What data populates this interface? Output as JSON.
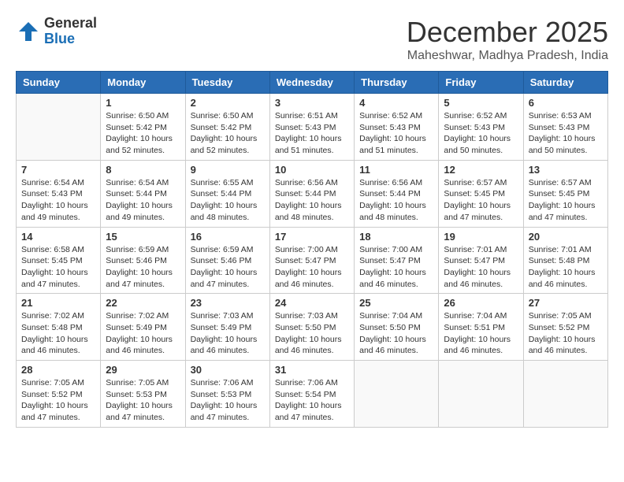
{
  "header": {
    "logo_general": "General",
    "logo_blue": "Blue",
    "month_title": "December 2025",
    "location": "Maheshwar, Madhya Pradesh, India"
  },
  "weekdays": [
    "Sunday",
    "Monday",
    "Tuesday",
    "Wednesday",
    "Thursday",
    "Friday",
    "Saturday"
  ],
  "weeks": [
    [
      {
        "day": "",
        "info": ""
      },
      {
        "day": "1",
        "info": "Sunrise: 6:50 AM\nSunset: 5:42 PM\nDaylight: 10 hours\nand 52 minutes."
      },
      {
        "day": "2",
        "info": "Sunrise: 6:50 AM\nSunset: 5:42 PM\nDaylight: 10 hours\nand 52 minutes."
      },
      {
        "day": "3",
        "info": "Sunrise: 6:51 AM\nSunset: 5:43 PM\nDaylight: 10 hours\nand 51 minutes."
      },
      {
        "day": "4",
        "info": "Sunrise: 6:52 AM\nSunset: 5:43 PM\nDaylight: 10 hours\nand 51 minutes."
      },
      {
        "day": "5",
        "info": "Sunrise: 6:52 AM\nSunset: 5:43 PM\nDaylight: 10 hours\nand 50 minutes."
      },
      {
        "day": "6",
        "info": "Sunrise: 6:53 AM\nSunset: 5:43 PM\nDaylight: 10 hours\nand 50 minutes."
      }
    ],
    [
      {
        "day": "7",
        "info": "Sunrise: 6:54 AM\nSunset: 5:43 PM\nDaylight: 10 hours\nand 49 minutes."
      },
      {
        "day": "8",
        "info": "Sunrise: 6:54 AM\nSunset: 5:44 PM\nDaylight: 10 hours\nand 49 minutes."
      },
      {
        "day": "9",
        "info": "Sunrise: 6:55 AM\nSunset: 5:44 PM\nDaylight: 10 hours\nand 48 minutes."
      },
      {
        "day": "10",
        "info": "Sunrise: 6:56 AM\nSunset: 5:44 PM\nDaylight: 10 hours\nand 48 minutes."
      },
      {
        "day": "11",
        "info": "Sunrise: 6:56 AM\nSunset: 5:44 PM\nDaylight: 10 hours\nand 48 minutes."
      },
      {
        "day": "12",
        "info": "Sunrise: 6:57 AM\nSunset: 5:45 PM\nDaylight: 10 hours\nand 47 minutes."
      },
      {
        "day": "13",
        "info": "Sunrise: 6:57 AM\nSunset: 5:45 PM\nDaylight: 10 hours\nand 47 minutes."
      }
    ],
    [
      {
        "day": "14",
        "info": "Sunrise: 6:58 AM\nSunset: 5:45 PM\nDaylight: 10 hours\nand 47 minutes."
      },
      {
        "day": "15",
        "info": "Sunrise: 6:59 AM\nSunset: 5:46 PM\nDaylight: 10 hours\nand 47 minutes."
      },
      {
        "day": "16",
        "info": "Sunrise: 6:59 AM\nSunset: 5:46 PM\nDaylight: 10 hours\nand 47 minutes."
      },
      {
        "day": "17",
        "info": "Sunrise: 7:00 AM\nSunset: 5:47 PM\nDaylight: 10 hours\nand 46 minutes."
      },
      {
        "day": "18",
        "info": "Sunrise: 7:00 AM\nSunset: 5:47 PM\nDaylight: 10 hours\nand 46 minutes."
      },
      {
        "day": "19",
        "info": "Sunrise: 7:01 AM\nSunset: 5:47 PM\nDaylight: 10 hours\nand 46 minutes."
      },
      {
        "day": "20",
        "info": "Sunrise: 7:01 AM\nSunset: 5:48 PM\nDaylight: 10 hours\nand 46 minutes."
      }
    ],
    [
      {
        "day": "21",
        "info": "Sunrise: 7:02 AM\nSunset: 5:48 PM\nDaylight: 10 hours\nand 46 minutes."
      },
      {
        "day": "22",
        "info": "Sunrise: 7:02 AM\nSunset: 5:49 PM\nDaylight: 10 hours\nand 46 minutes."
      },
      {
        "day": "23",
        "info": "Sunrise: 7:03 AM\nSunset: 5:49 PM\nDaylight: 10 hours\nand 46 minutes."
      },
      {
        "day": "24",
        "info": "Sunrise: 7:03 AM\nSunset: 5:50 PM\nDaylight: 10 hours\nand 46 minutes."
      },
      {
        "day": "25",
        "info": "Sunrise: 7:04 AM\nSunset: 5:50 PM\nDaylight: 10 hours\nand 46 minutes."
      },
      {
        "day": "26",
        "info": "Sunrise: 7:04 AM\nSunset: 5:51 PM\nDaylight: 10 hours\nand 46 minutes."
      },
      {
        "day": "27",
        "info": "Sunrise: 7:05 AM\nSunset: 5:52 PM\nDaylight: 10 hours\nand 46 minutes."
      }
    ],
    [
      {
        "day": "28",
        "info": "Sunrise: 7:05 AM\nSunset: 5:52 PM\nDaylight: 10 hours\nand 47 minutes."
      },
      {
        "day": "29",
        "info": "Sunrise: 7:05 AM\nSunset: 5:53 PM\nDaylight: 10 hours\nand 47 minutes."
      },
      {
        "day": "30",
        "info": "Sunrise: 7:06 AM\nSunset: 5:53 PM\nDaylight: 10 hours\nand 47 minutes."
      },
      {
        "day": "31",
        "info": "Sunrise: 7:06 AM\nSunset: 5:54 PM\nDaylight: 10 hours\nand 47 minutes."
      },
      {
        "day": "",
        "info": ""
      },
      {
        "day": "",
        "info": ""
      },
      {
        "day": "",
        "info": ""
      }
    ]
  ]
}
